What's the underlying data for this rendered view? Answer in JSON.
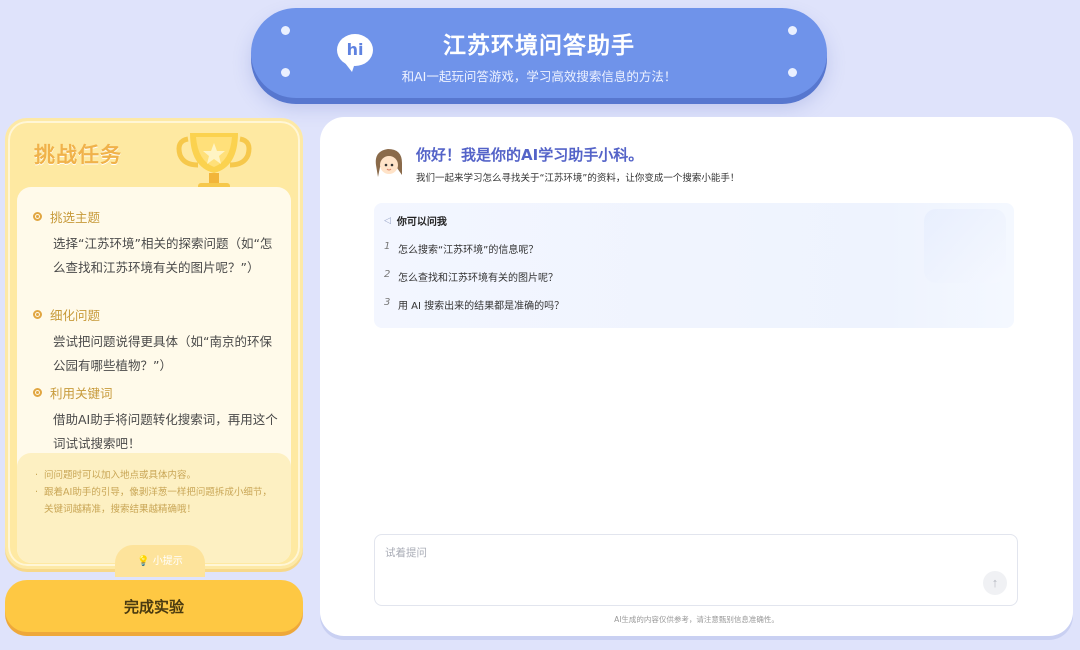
{
  "header": {
    "badge": "hi",
    "title": "江苏环境问答助手",
    "subtitle": "和AI一起玩问答游戏，学习高效搜索信息的方法！"
  },
  "task": {
    "title": "挑战任务",
    "steps": [
      {
        "title": "挑选主题",
        "body": "选择“江苏环境”相关的探索问题（如“怎么查找和江苏环境有关的图片呢？”）"
      },
      {
        "title": "细化问题",
        "body": "尝试把问题说得更具体（如“南京的环保公园有哪些植物？”）"
      },
      {
        "title": "利用关键词",
        "body": "借助AI助手将问题转化搜索词，再用这个词试试搜索吧！"
      }
    ],
    "tips": [
      "问问题时可以加入地点或具体内容。",
      "跟着AI助手的引导，像剥洋葱一样把问题拆成小细节，关键词越精准，搜索结果越精确哦！"
    ],
    "tips_badge": "小提示",
    "finish_label": "完成实验"
  },
  "chat": {
    "greeting_title": "你好！我是你的AI学习助手小科。",
    "greeting_sub": "我们一起来学习怎么寻找关于“江苏环境”的资料，让你变成一个搜索小能手！",
    "ask_header": "你可以问我",
    "questions": [
      {
        "num": "1",
        "text": "怎么搜索“江苏环境”的信息呢？"
      },
      {
        "num": "2",
        "text": "怎么查找和江苏环境有关的图片呢？"
      },
      {
        "num": "3",
        "text": "用 AI 搜索出来的结果都是准确的吗？"
      }
    ],
    "input_placeholder": "试着提问",
    "disclaimer": "AI生成的内容仅供参考，请注意甄别信息准确性。"
  },
  "colors": {
    "banner": "#6f93ea",
    "task_card": "#fee9a2",
    "finish_button": "#fec843",
    "greeting_title": "#5463c8"
  }
}
